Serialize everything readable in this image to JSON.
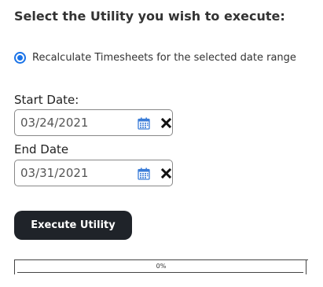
{
  "heading": "Select the Utility you wish to execute:",
  "utility_option": {
    "label": "Recalculate Timesheets for the selected date range",
    "selected": true
  },
  "start_date": {
    "label": "Start Date:",
    "value": "03/24/2021"
  },
  "end_date": {
    "label": "End Date",
    "value": "03/31/2021"
  },
  "execute_button": {
    "label": "Execute Utility"
  },
  "progress": {
    "text": "0%",
    "fraction": 0
  },
  "colors": {
    "accent": "#1a73e8",
    "button_bg": "#1f2329",
    "calendar_icon": "#3b7dd8"
  },
  "icons": {
    "calendar": "calendar-icon",
    "clear": "close-icon"
  }
}
